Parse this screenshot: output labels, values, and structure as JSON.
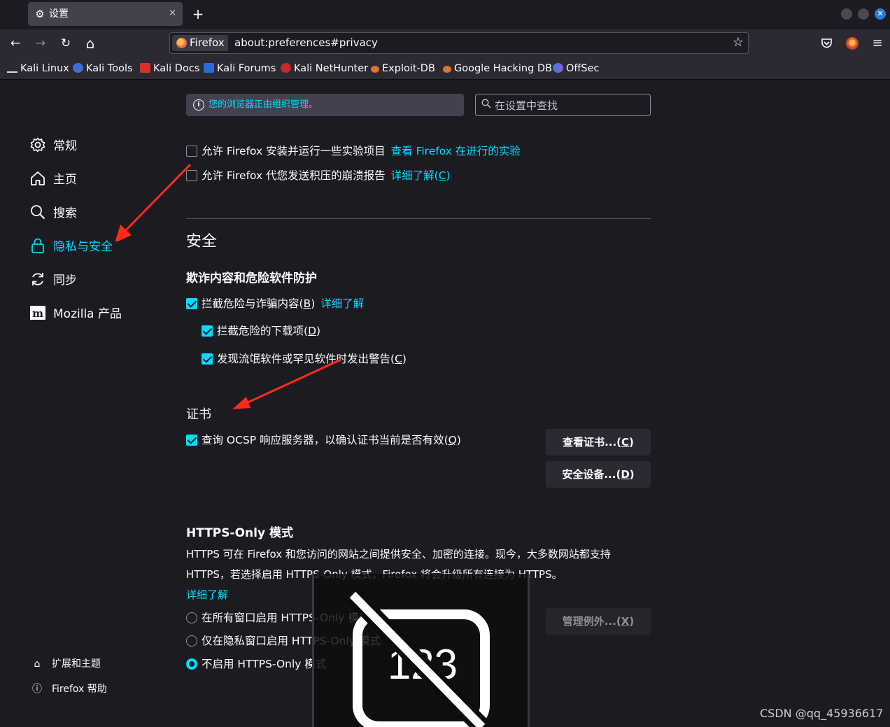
{
  "colors": {
    "accent": "#00ddff",
    "background": "#1c1b22",
    "arrow": "#ff2a1a"
  },
  "tab": {
    "icon": "gear-icon",
    "title": "设置",
    "close": "×"
  },
  "newtab": "+",
  "nav": {
    "back": "←",
    "forward": "→",
    "reload": "↻",
    "home": "⌂"
  },
  "urlbar": {
    "identity_label": "Firefox",
    "url": "about:preferences#privacy",
    "star": "☆"
  },
  "bookmarks": [
    {
      "label": "Kali Linux",
      "icon": "kali-dragon-icon"
    },
    {
      "label": "Kali Tools",
      "icon": "kali-tools-icon"
    },
    {
      "label": "Kali Docs",
      "icon": "kali-docs-icon"
    },
    {
      "label": "Kali Forums",
      "icon": "kali-forums-icon"
    },
    {
      "label": "Kali NetHunter",
      "icon": "nethunter-icon"
    },
    {
      "label": "Exploit-DB",
      "icon": "exploitdb-icon"
    },
    {
      "label": "Google Hacking DB",
      "icon": "ghdb-icon"
    },
    {
      "label": "OffSec",
      "icon": "offsec-icon"
    }
  ],
  "sidebar": {
    "items": [
      {
        "label": "常规",
        "icon": "gear-icon",
        "selected": false
      },
      {
        "label": "主页",
        "icon": "home-icon",
        "selected": false
      },
      {
        "label": "搜索",
        "icon": "search-icon",
        "selected": false
      },
      {
        "label": "隐私与安全",
        "icon": "lock-icon",
        "selected": true
      },
      {
        "label": "同步",
        "icon": "sync-icon",
        "selected": false
      },
      {
        "label": "Mozilla 产品",
        "icon": "mozilla-icon",
        "selected": false
      }
    ],
    "footer": [
      {
        "label": "扩展和主题",
        "icon": "puzzle-icon"
      },
      {
        "label": "Firefox 帮助",
        "icon": "help-icon"
      }
    ]
  },
  "policy_notice": "您的浏览器正由组织管理。",
  "search": {
    "placeholder": "在设置中查找"
  },
  "data_collection": {
    "studies": {
      "label": "允许 Firefox 安装并运行一些实验项目",
      "link": "查看 Firefox 在进行的实验",
      "checked": false
    },
    "crash_reports": {
      "label": "允许 Firefox 代您发送积压的崩溃报告",
      "link_prefix": "详细了解(",
      "link_key": "C",
      "link_suffix": ")",
      "checked": false
    }
  },
  "security": {
    "heading": "安全",
    "phishing": {
      "heading": "欺诈内容和危险软件防护",
      "block_dangerous": {
        "prefix": "拦截危险与诈骗内容(",
        "key": "B",
        "suffix": ")",
        "link": "详细了解",
        "checked": true
      },
      "block_downloads": {
        "prefix": "拦截危险的下载项(",
        "key": "D",
        "suffix": ")",
        "checked": true
      },
      "warn_unwanted": {
        "prefix": "发现流氓软件或罕见软件时发出警告(",
        "key": "C",
        "suffix": ")",
        "checked": true
      }
    },
    "certificates": {
      "heading": "证书",
      "ocsp": {
        "prefix": "查询 OCSP 响应服务器，以确认证书当前是否有效(",
        "key": "Q",
        "suffix": ")",
        "checked": true
      },
      "view_button": {
        "prefix": "查看证书...(",
        "key": "C",
        "suffix": ")"
      },
      "devices_button": {
        "prefix": "安全设备...(",
        "key": "D",
        "suffix": ")"
      }
    },
    "https_only": {
      "heading": "HTTPS-Only 模式",
      "description_line1": "HTTPS 可在 Firefox 和您访问的网站之间提供安全、加密的连接。现今，大多数网站都支持",
      "description_line2": "HTTPS，若选择启用 HTTPS-Only 模式，Firefox 将会升级所有连接为 HTTPS。",
      "learn_more": "详细了解",
      "options": [
        {
          "label": "在所有窗口启用 HTTPS-Only 模式",
          "selected": false
        },
        {
          "label": "仅在隐私窗口启用 HTTPS-Only 模式",
          "selected": false
        },
        {
          "label": "不启用 HTTPS-Only 模式",
          "selected": true
        }
      ],
      "exceptions_button": {
        "prefix": "管理例外...(",
        "key": "X",
        "suffix": ")",
        "disabled": true
      }
    }
  },
  "overlay": {
    "icon": "keyboard-disabled-icon",
    "text": "123"
  },
  "watermark": "CSDN @qq_45936617"
}
